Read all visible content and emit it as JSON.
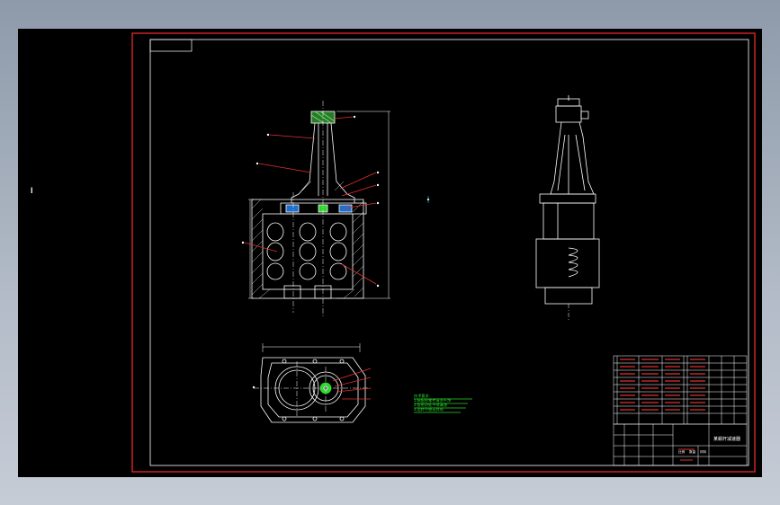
{
  "side_marker": "l",
  "title_block": {
    "drawing_title": "某蜗杆减速器",
    "labels": [
      "比例",
      "数量",
      "材料"
    ]
  },
  "note_lines": [
    "技术要求",
    "1.装配前零件清洗干净",
    "2.各密封处不得漏油",
    "3.运转平稳无异响"
  ],
  "colors": {
    "background": "#000000",
    "frame": "#cc2222",
    "lines": "#ffffff",
    "leader": "#e23030",
    "note": "#2bd82b",
    "center_mark": "#23c8c8"
  }
}
